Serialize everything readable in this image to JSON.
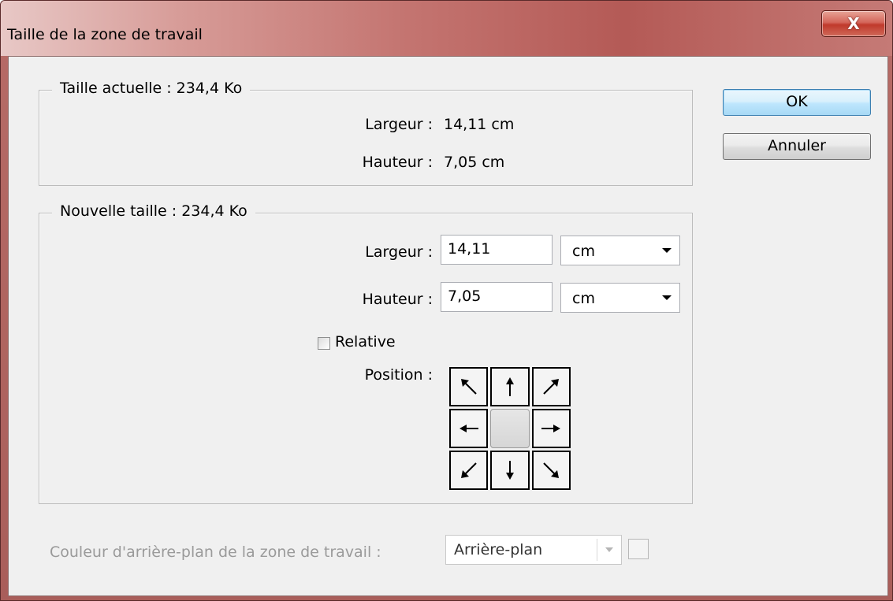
{
  "window": {
    "title": "Taille de la zone de travail",
    "close_label": "X"
  },
  "current": {
    "title": "Taille actuelle : 234,4 Ko",
    "width_label": "Largeur :",
    "width_value": "14,11 cm",
    "height_label": "Hauteur :",
    "height_value": "7,05 cm"
  },
  "new_size": {
    "title": "Nouvelle taille : 234,4 Ko",
    "width_label": "Largeur :",
    "width_value": "14,11",
    "width_unit": "cm",
    "height_label": "Hauteur :",
    "height_value": "7,05",
    "height_unit": "cm",
    "relative_label": "Relative",
    "relative_checked": false,
    "position_label": "Position :",
    "anchor_selected": "center"
  },
  "buttons": {
    "ok": "OK",
    "cancel": "Annuler"
  },
  "background": {
    "label": "Couleur d'arrière-plan de la zone de travail :",
    "value": "Arrière-plan"
  }
}
